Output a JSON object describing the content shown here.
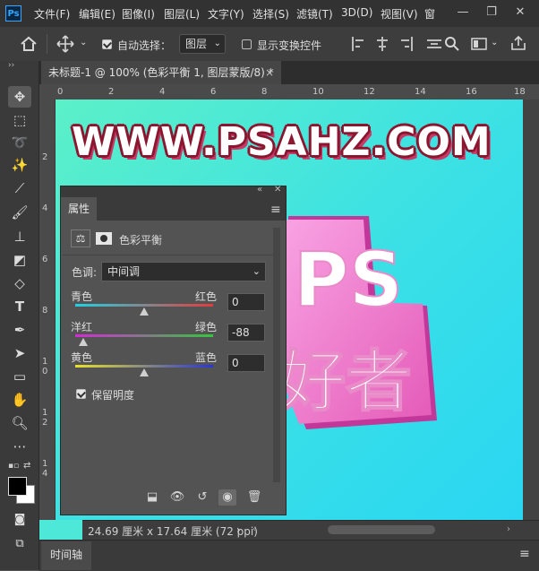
{
  "app": {
    "logo_text": "Ps"
  },
  "menu": [
    "文件(F)",
    "编辑(E)",
    "图像(I)",
    "图层(L)",
    "文字(Y)",
    "选择(S)",
    "滤镜(T)",
    "3D(D)",
    "视图(V)",
    "窗"
  ],
  "window_controls": {
    "minimize": "—",
    "restore": "❐",
    "close": "✕"
  },
  "options_bar": {
    "auto_select_label": "自动选择：",
    "auto_select_checked": true,
    "layer_select_value": "图层",
    "show_transform_label": "显示变换控件",
    "show_transform_checked": false
  },
  "document_tab": {
    "title": "未标题-1 @ 100% (色彩平衡 1, 图层蒙版/8) *",
    "close": "×"
  },
  "ruler": {
    "h_ticks": [
      "0",
      "2",
      "4",
      "6",
      "8",
      "10",
      "12",
      "14",
      "16",
      "18"
    ],
    "v_ticks": [
      "2",
      "4",
      "6",
      "8",
      "1\n0",
      "1\n2",
      "1\n4"
    ]
  },
  "canvas": {
    "banner_text": "WWW.PSAHZ.COM",
    "art_text_top": "PS",
    "art_text_bottom": "好者"
  },
  "properties_panel": {
    "tab_label": "属性",
    "adjustment_title": "色彩平衡",
    "tone_label": "色调:",
    "tone_value": "中间调",
    "sliders": [
      {
        "left_label": "青色",
        "right_label": "红色",
        "value": "0",
        "amount": 0
      },
      {
        "left_label": "洋红",
        "right_label": "绿色",
        "value": "-88",
        "amount": -88
      },
      {
        "left_label": "黄色",
        "right_label": "蓝色",
        "value": "0",
        "amount": 0
      }
    ],
    "preserve_luminosity_label": "保留明度",
    "preserve_luminosity_checked": true
  },
  "status_bar": {
    "text": "24.69 厘米 x 17.64 厘米 (72 ppi)",
    "arrow": "›"
  },
  "timeline": {
    "tab_label": "时间轴"
  },
  "colors": {
    "accent": "#31a8ff",
    "banner_outline": "#8a1630",
    "canvas_start": "#5bf0c8",
    "canvas_end": "#2ad6f2",
    "art_pink": "#f06cc8"
  }
}
